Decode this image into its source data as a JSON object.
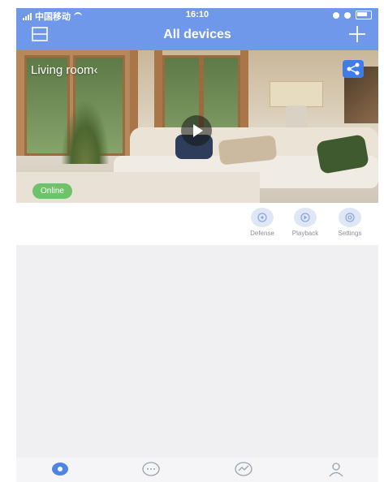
{
  "status_bar": {
    "carrier": "中国移动",
    "time": "16:10"
  },
  "header": {
    "title": "All devices"
  },
  "camera": {
    "name": "Living room",
    "status": "Online"
  },
  "actions": [
    {
      "label": "Defense",
      "icon": "shield-icon"
    },
    {
      "label": "Playback",
      "icon": "playback-icon"
    },
    {
      "label": "Settings",
      "icon": "gear-icon"
    }
  ],
  "tabbar": {
    "tabs": [
      {
        "icon": "camera-icon",
        "active": true
      },
      {
        "icon": "message-icon",
        "active": false
      },
      {
        "icon": "discover-icon",
        "active": false
      },
      {
        "icon": "user-icon",
        "active": false
      }
    ]
  },
  "colors": {
    "accent": "#6f97ea",
    "online": "#6ec26a"
  }
}
